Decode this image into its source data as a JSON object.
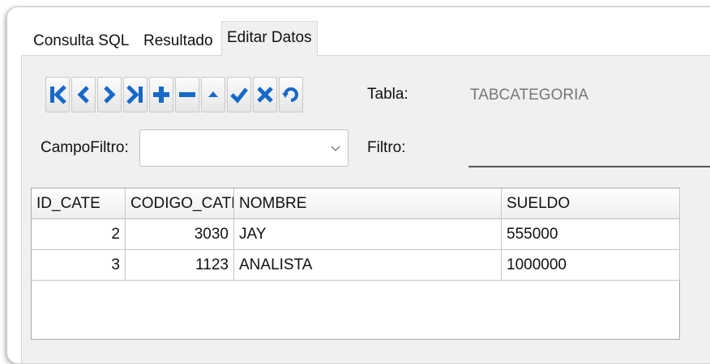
{
  "tabs": [
    {
      "label": "Consulta SQL",
      "active": false
    },
    {
      "label": "Resultado",
      "active": false
    },
    {
      "label": "Editar Datos",
      "active": true
    }
  ],
  "toolbar": {
    "buttons": [
      {
        "name": "first-record",
        "icon": "first-record-icon"
      },
      {
        "name": "prior-record",
        "icon": "prior-record-icon"
      },
      {
        "name": "next-record",
        "icon": "next-record-icon"
      },
      {
        "name": "last-record",
        "icon": "last-record-icon"
      },
      {
        "name": "insert-record",
        "icon": "plus-icon"
      },
      {
        "name": "delete-record",
        "icon": "minus-icon"
      },
      {
        "name": "edit-record",
        "icon": "caret-up-icon"
      },
      {
        "name": "post-record",
        "icon": "checkmark-icon"
      },
      {
        "name": "cancel-edit",
        "icon": "x-icon"
      },
      {
        "name": "refresh-data",
        "icon": "refresh-icon"
      }
    ],
    "icon_color": "#1769c8"
  },
  "tabla": {
    "label": "Tabla:",
    "value": "TABCATEGORIA"
  },
  "campo_filtro": {
    "label": "CampoFiltro:",
    "value": ""
  },
  "filtro": {
    "label": "Filtro:",
    "value": ""
  },
  "grid": {
    "columns": [
      "ID_CATE",
      "CODIGO_CATE",
      "NOMBRE",
      "SUELDO"
    ],
    "rows": [
      [
        "2",
        "3030",
        "JAY",
        "555000"
      ],
      [
        "3",
        "1123",
        "ANALISTA",
        "1000000"
      ]
    ]
  }
}
